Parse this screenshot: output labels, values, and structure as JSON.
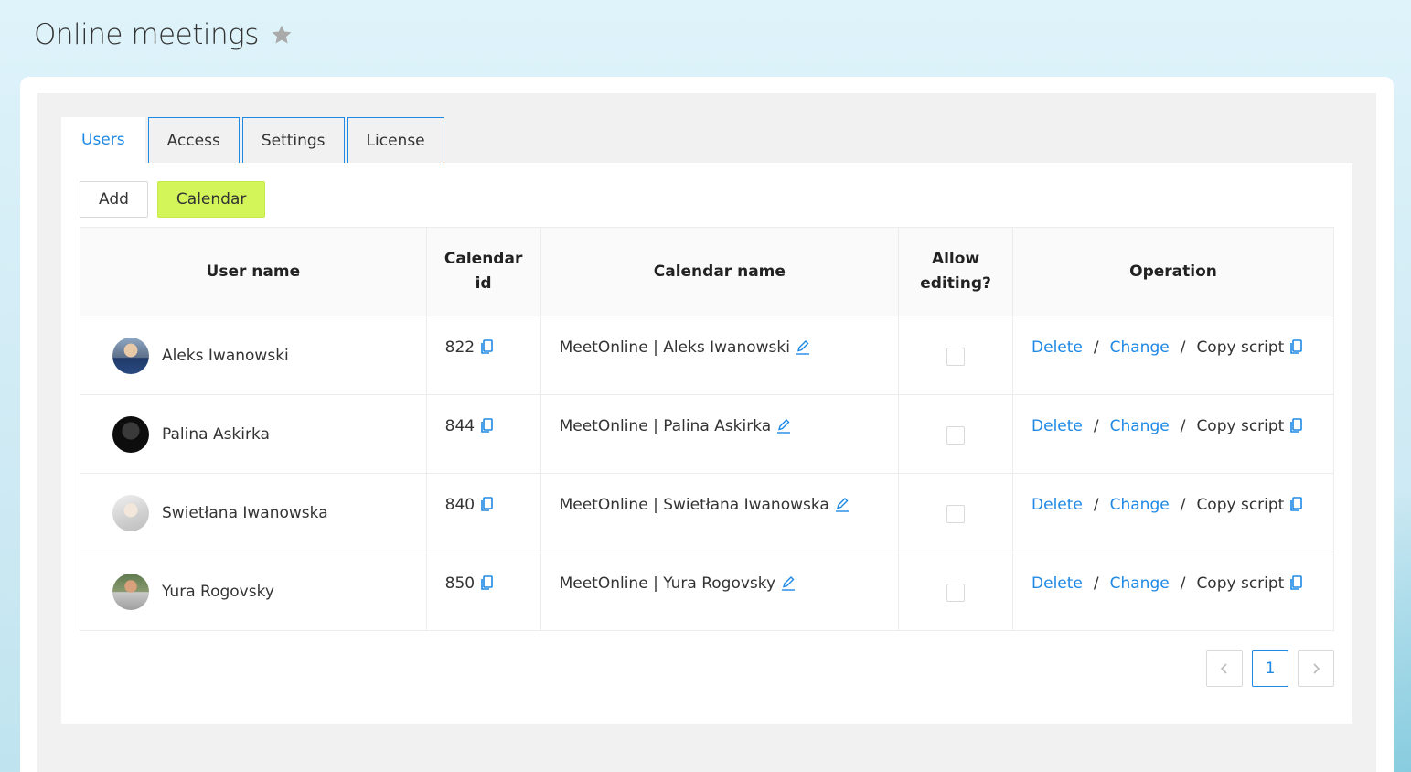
{
  "page": {
    "title": "Online meetings"
  },
  "tabs": [
    {
      "label": "Users",
      "active": true
    },
    {
      "label": "Access",
      "active": false
    },
    {
      "label": "Settings",
      "active": false
    },
    {
      "label": "License",
      "active": false
    }
  ],
  "toolbar": {
    "add_label": "Add",
    "calendar_label": "Calendar"
  },
  "table": {
    "headers": {
      "user_name": "User name",
      "calendar_id_line1": "Calendar",
      "calendar_id_line2": "id",
      "calendar_name": "Calendar name",
      "allow_line1": "Allow",
      "allow_line2": "editing?",
      "operation": "Operation"
    },
    "rows": [
      {
        "user": "Aleks Iwanowski",
        "calendar_id": "822",
        "calendar_name": "MeetOnline | Aleks Iwanowski",
        "allow_editing": false
      },
      {
        "user": "Palina Askirka",
        "calendar_id": "844",
        "calendar_name": "MeetOnline | Palina Askirka",
        "allow_editing": false
      },
      {
        "user": "Swietłana Iwanowska",
        "calendar_id": "840",
        "calendar_name": "MeetOnline | Swietłana Iwanowska",
        "allow_editing": false
      },
      {
        "user": "Yura Rogovsky",
        "calendar_id": "850",
        "calendar_name": "MeetOnline | Yura Rogovsky",
        "allow_editing": false
      }
    ],
    "operations": {
      "delete": "Delete",
      "change": "Change",
      "copy": "Copy script",
      "separator": "/"
    }
  },
  "pagination": {
    "current": "1",
    "prev_icon": "chevron-left-icon",
    "next_icon": "chevron-right-icon"
  },
  "colors": {
    "accent": "#1e88e5",
    "calendar_button": "#d3f55a"
  }
}
